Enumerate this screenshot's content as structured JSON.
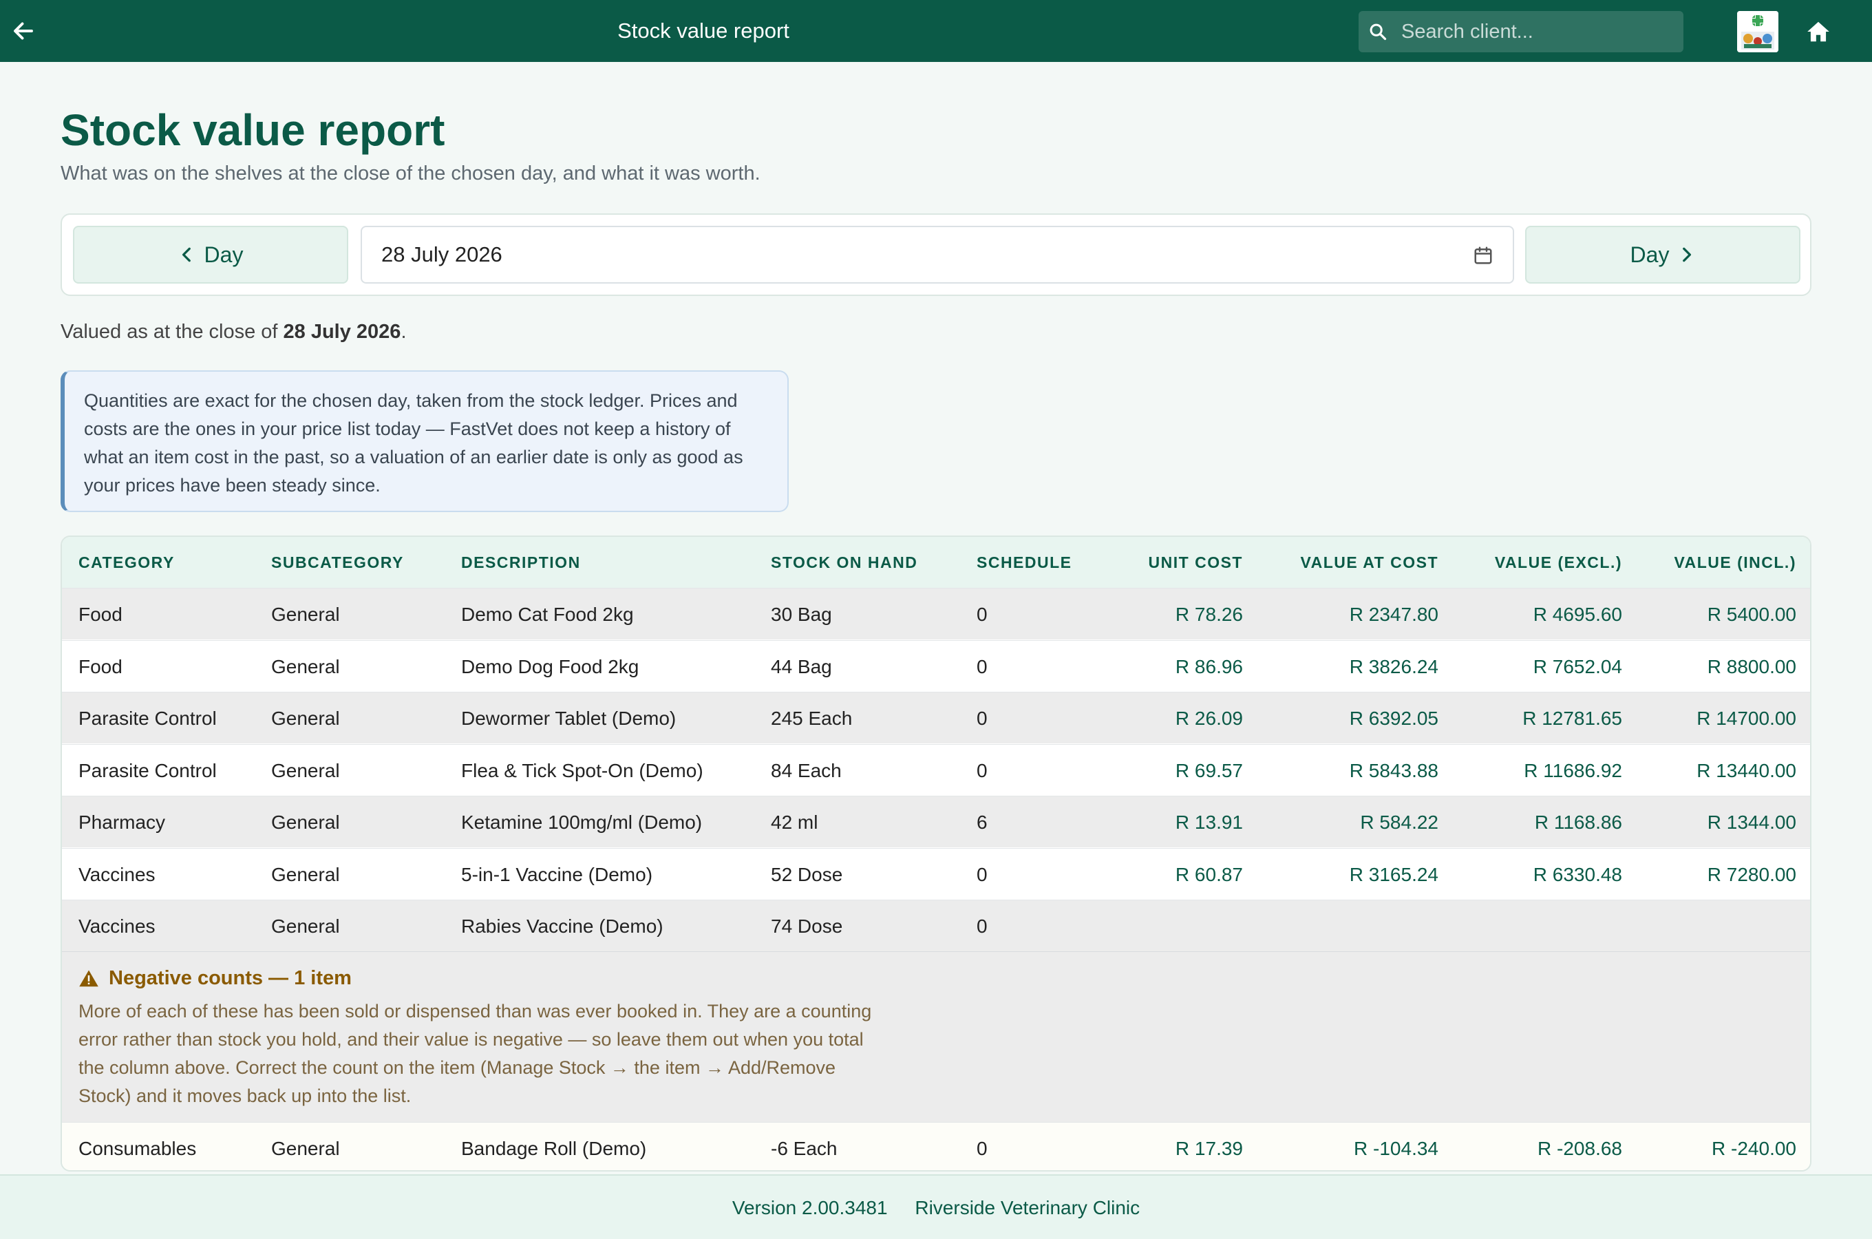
{
  "topbar": {
    "title": "Stock value report",
    "search_placeholder": "Search client..."
  },
  "page": {
    "heading": "Stock value report",
    "subtitle": "What was on the shelves at the close of the chosen day, and what it was worth."
  },
  "datenav": {
    "prev_label": "Day",
    "next_label": "Day",
    "date_value": "28 July 2026"
  },
  "valued": {
    "prefix": "Valued as at the close of ",
    "date": "28 July 2026",
    "suffix": "."
  },
  "info_text": "Quantities are exact for the chosen day, taken from the stock ledger. Prices and costs are the ones in your price list today — FastVet does not keep a history of what an item cost in the past, so a valuation of an earlier date is only as good as your prices have been steady since.",
  "table": {
    "headers": [
      "Category",
      "Subcategory",
      "Description",
      "Stock on hand",
      "Schedule",
      "Unit cost",
      "Value at cost",
      "Value (excl.)",
      "Value (incl.)"
    ],
    "rows": [
      [
        "Food",
        "General",
        "Demo Cat Food 2kg",
        "30 Bag",
        "0",
        "R 78.26",
        "R 2347.80",
        "R 4695.60",
        "R 5400.00"
      ],
      [
        "Food",
        "General",
        "Demo Dog Food 2kg",
        "44 Bag",
        "0",
        "R 86.96",
        "R 3826.24",
        "R 7652.04",
        "R 8800.00"
      ],
      [
        "Parasite Control",
        "General",
        "Dewormer Tablet (Demo)",
        "245 Each",
        "0",
        "R 26.09",
        "R 6392.05",
        "R 12781.65",
        "R 14700.00"
      ],
      [
        "Parasite Control",
        "General",
        "Flea & Tick Spot-On (Demo)",
        "84 Each",
        "0",
        "R 69.57",
        "R 5843.88",
        "R 11686.92",
        "R 13440.00"
      ],
      [
        "Pharmacy",
        "General",
        "Ketamine 100mg/ml (Demo)",
        "42 ml",
        "6",
        "R 13.91",
        "R 584.22",
        "R 1168.86",
        "R 1344.00"
      ],
      [
        "Vaccines",
        "General",
        "5-in-1 Vaccine (Demo)",
        "52 Dose",
        "0",
        "R 60.87",
        "R 3165.24",
        "R 6330.48",
        "R 7280.00"
      ],
      [
        "Vaccines",
        "General",
        "Rabies Vaccine (Demo)",
        "74 Dose",
        "0",
        "",
        "",
        "",
        ""
      ]
    ],
    "negative": {
      "heading": "Negative counts — 1 item",
      "text": "More of each of these has been sold or dispensed than was ever booked in. They are a counting error rather than stock you hold, and their value is negative — so leave them out when you total the column above. Correct the count on the item (Manage Stock → the item → Add/Remove Stock) and it moves back up into the list.",
      "rows": [
        [
          "Consumables",
          "General",
          "Bandage Roll (Demo)",
          "-6 Each",
          "0",
          "R 17.39",
          "R -104.34",
          "R -208.68",
          "R -240.00"
        ]
      ]
    }
  },
  "footer": {
    "version": "Version 2.00.3481",
    "clinic": "Riverside Veterinary Clinic"
  }
}
